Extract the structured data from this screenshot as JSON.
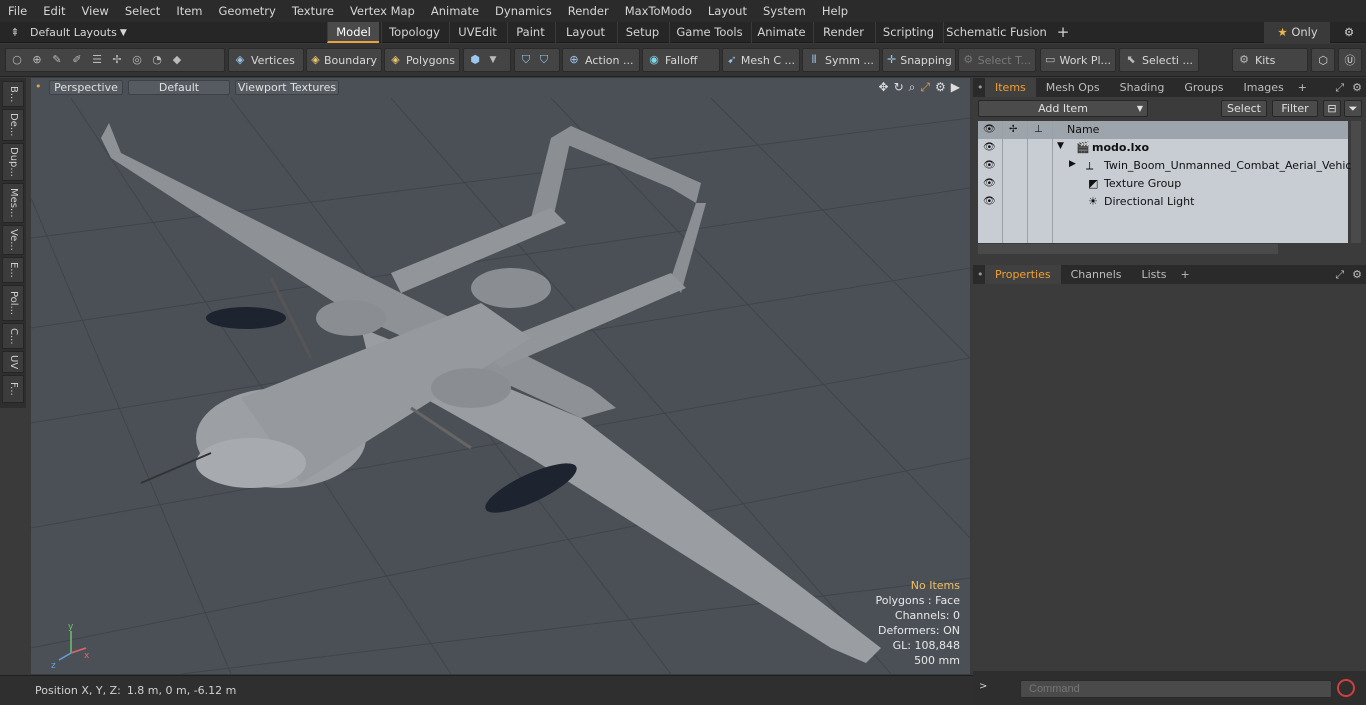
{
  "menu": [
    "File",
    "Edit",
    "View",
    "Select",
    "Item",
    "Geometry",
    "Texture",
    "Vertex Map",
    "Animate",
    "Dynamics",
    "Render",
    "MaxToModo",
    "Layout",
    "System",
    "Help"
  ],
  "layouts_label": "Default Layouts",
  "mode_tabs": [
    "Model",
    "Topology",
    "UVEdit",
    "Paint",
    "Layout",
    "Setup",
    "Game Tools",
    "Animate",
    "Render",
    "Scripting",
    "Schematic Fusion"
  ],
  "active_tab": "Model",
  "only_label": "Only",
  "toolbar": {
    "vertices": "Vertices",
    "boundary": "Boundary",
    "polygons": "Polygons",
    "action": "Action ...",
    "falloff": "Falloff",
    "mesh": "Mesh C ...",
    "symm": "Symm ...",
    "snapping": "Snapping",
    "select_t": "Select T...",
    "work_pl": "Work Pl...",
    "selecti": "Selecti ...",
    "kits": "Kits"
  },
  "left_tabs": [
    "B...",
    "De...",
    "Dup...",
    "Mes...",
    "Ve...",
    "E...",
    "Pol...",
    "C...",
    "UV",
    "F..."
  ],
  "viewport": {
    "view": "Perspective",
    "shading": "Default",
    "textures": "Viewport Textures",
    "stats": {
      "selection": "No Items",
      "polygons": "Polygons : Face",
      "channels": "Channels: 0",
      "deformers": "Deformers: ON",
      "gl": "GL: 108,848",
      "scale": "500 mm"
    }
  },
  "status": {
    "position_label": "Position X, Y, Z:",
    "position_value": "1.8 m, 0 m, -6.12 m"
  },
  "items_panel": {
    "tabs": [
      "Items",
      "Mesh Ops",
      "Shading",
      "Groups",
      "Images"
    ],
    "add_item": "Add Item",
    "select": "Select",
    "filter": "Filter",
    "name_header": "Name",
    "rows": [
      "modo.lxo",
      "Twin_Boom_Unmanned_Combat_Aerial_Vehicle",
      "Texture Group",
      "Directional Light"
    ]
  },
  "properties_panel": {
    "tabs": [
      "Properties",
      "Channels",
      "Lists"
    ]
  },
  "command_placeholder": "Command",
  "colors": {
    "accent": "#e8a33d",
    "viewport_bg": "#4b5057",
    "list_bg": "#c8cdd3"
  }
}
